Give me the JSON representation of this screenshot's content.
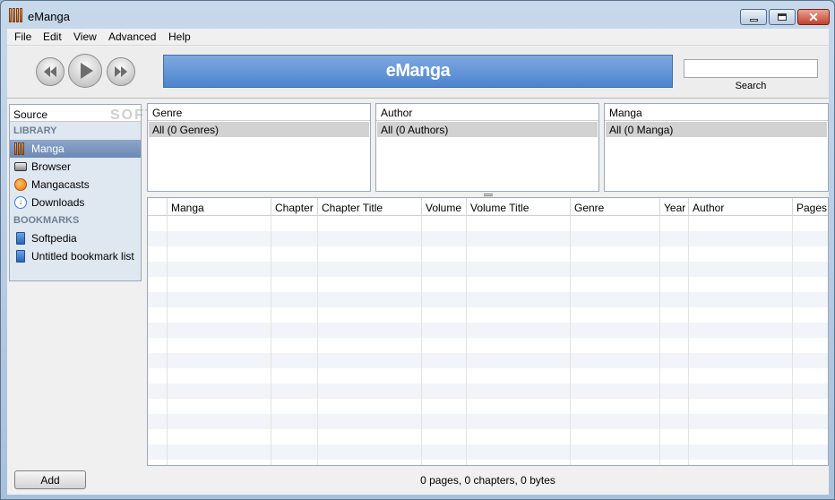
{
  "window": {
    "title": "eManga"
  },
  "menu": [
    "File",
    "Edit",
    "View",
    "Advanced",
    "Help"
  ],
  "toolbar": {
    "display_title": "eManga",
    "search_placeholder": "",
    "search_label": "Search"
  },
  "source": {
    "header": "Source",
    "groups": [
      {
        "label": "LIBRARY",
        "items": [
          {
            "label": "Manga",
            "icon": "manga-icon",
            "selected": true
          },
          {
            "label": "Browser",
            "icon": "browser-icon"
          },
          {
            "label": "Mangacasts",
            "icon": "rss-icon"
          },
          {
            "label": "Downloads",
            "icon": "download-icon"
          }
        ]
      },
      {
        "label": "BOOKMARKS",
        "items": [
          {
            "label": "Softpedia",
            "icon": "bookmark-icon"
          },
          {
            "label": "Untitled bookmark list",
            "icon": "bookmark-icon"
          }
        ]
      }
    ]
  },
  "browser": {
    "genre": {
      "header": "Genre",
      "row": "All (0 Genres)"
    },
    "author": {
      "header": "Author",
      "row": "All (0 Authors)"
    },
    "manga": {
      "header": "Manga",
      "row": "All (0 Manga)"
    }
  },
  "table": {
    "columns": [
      "",
      "Manga",
      "Chapter",
      "Chapter Title",
      "Volume",
      "Volume Title",
      "Genre",
      "Year",
      "Author",
      "Pages"
    ]
  },
  "footer": {
    "add_label": "Add",
    "status": "0 pages, 0 chapters, 0 bytes"
  },
  "watermark": "SOFTPEDIA",
  "colors": {
    "lcd": "#4c84cf",
    "selection": "#6c89b5"
  }
}
